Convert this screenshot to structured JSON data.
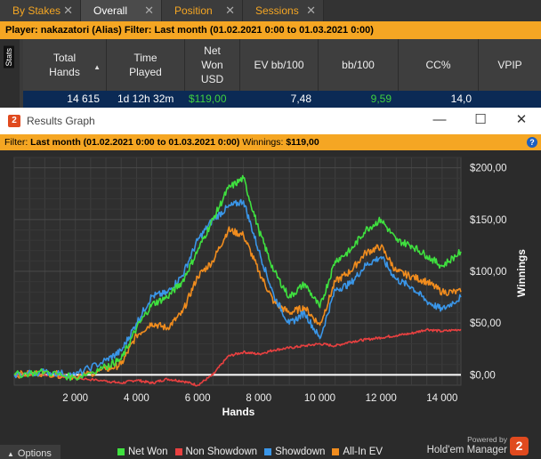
{
  "tabs": [
    {
      "label": "By Stakes",
      "active": false
    },
    {
      "label": "Overall",
      "active": true
    },
    {
      "label": "Position",
      "active": false
    },
    {
      "label": "Sessions",
      "active": false
    }
  ],
  "tab_close_glyph": "✕",
  "player_filter": "Player: nakazatori (Alias)   Filter: Last month (01.02.2021 0:00 to 01.03.2021 0:00)",
  "stats_label": "Stats",
  "table": {
    "headers": [
      "Total Hands",
      "Time Played",
      "Net Won USD",
      "EV bb/100",
      "bb/100",
      "CC%",
      "VPIP"
    ],
    "row": [
      "14 615",
      "1d 12h 32m",
      "$119,00",
      "7,48",
      "9,59",
      "14,0",
      ""
    ]
  },
  "window": {
    "title": "Results Graph",
    "logo_text": "2",
    "minimize": "—",
    "maximize": "☐",
    "close": "✕"
  },
  "graph_filter": {
    "filter_label": "Filter:",
    "filter_value": "Last month (01.02.2021 0:00 to 01.03.2021 0:00)",
    "winnings_label": "Winnings:",
    "winnings_value": "$119,00",
    "help": "?"
  },
  "options_label": "Options",
  "powered_by": "Powered by",
  "brand": "Hold'em Manager",
  "brand_logo": "2",
  "colors": {
    "accent": "#f5a623",
    "net_won": "#3fe03f",
    "non_showdown": "#e84040",
    "showdown": "#3a96e8",
    "all_in_ev": "#f08c1e"
  },
  "chart_data": {
    "type": "line",
    "xlabel": "Hands",
    "ylabel": "Winnings",
    "xlim": [
      0,
      14615
    ],
    "ylim": [
      -10,
      210
    ],
    "x_ticks": [
      2000,
      4000,
      6000,
      8000,
      10000,
      12000,
      14000
    ],
    "x_tick_labels": [
      "2 000",
      "4 000",
      "6 000",
      "8 000",
      "10 000",
      "12 000",
      "14 000"
    ],
    "y_ticks": [
      0,
      50,
      100,
      150,
      200
    ],
    "y_tick_labels": [
      "$0,00",
      "$50,00",
      "$100,00",
      "$150,00",
      "$200,00"
    ],
    "grid": true,
    "legend_position": "bottom",
    "x": [
      0,
      1000,
      2000,
      3000,
      3500,
      4000,
      4500,
      5000,
      5500,
      6000,
      6500,
      7000,
      7500,
      8000,
      8500,
      9000,
      9500,
      10000,
      10500,
      11000,
      11500,
      12000,
      12500,
      13000,
      13500,
      14000,
      14615
    ],
    "series": [
      {
        "name": "Net Won",
        "color": "#3fe03f",
        "values": [
          0,
          3,
          -3,
          8,
          15,
          45,
          68,
          75,
          90,
          120,
          150,
          180,
          190,
          140,
          100,
          75,
          88,
          65,
          110,
          120,
          140,
          150,
          130,
          125,
          115,
          105,
          119
        ]
      },
      {
        "name": "Non Showdown",
        "color": "#e84040",
        "values": [
          0,
          0,
          -3,
          -6,
          -8,
          -5,
          -8,
          -4,
          -6,
          -10,
          0,
          18,
          22,
          20,
          24,
          26,
          28,
          30,
          28,
          32,
          34,
          36,
          38,
          40,
          44,
          42,
          44
        ]
      },
      {
        "name": "Showdown",
        "color": "#3a96e8",
        "values": [
          0,
          3,
          0,
          14,
          23,
          50,
          76,
          79,
          96,
          130,
          150,
          162,
          168,
          120,
          76,
          49,
          60,
          35,
          82,
          88,
          106,
          114,
          92,
          85,
          71,
          63,
          75
        ]
      },
      {
        "name": "All-In EV",
        "color": "#f08c1e",
        "values": [
          0,
          2,
          -2,
          5,
          10,
          38,
          50,
          45,
          60,
          95,
          110,
          140,
          135,
          100,
          70,
          60,
          65,
          48,
          90,
          100,
          118,
          124,
          100,
          95,
          90,
          80,
          80
        ]
      }
    ]
  }
}
